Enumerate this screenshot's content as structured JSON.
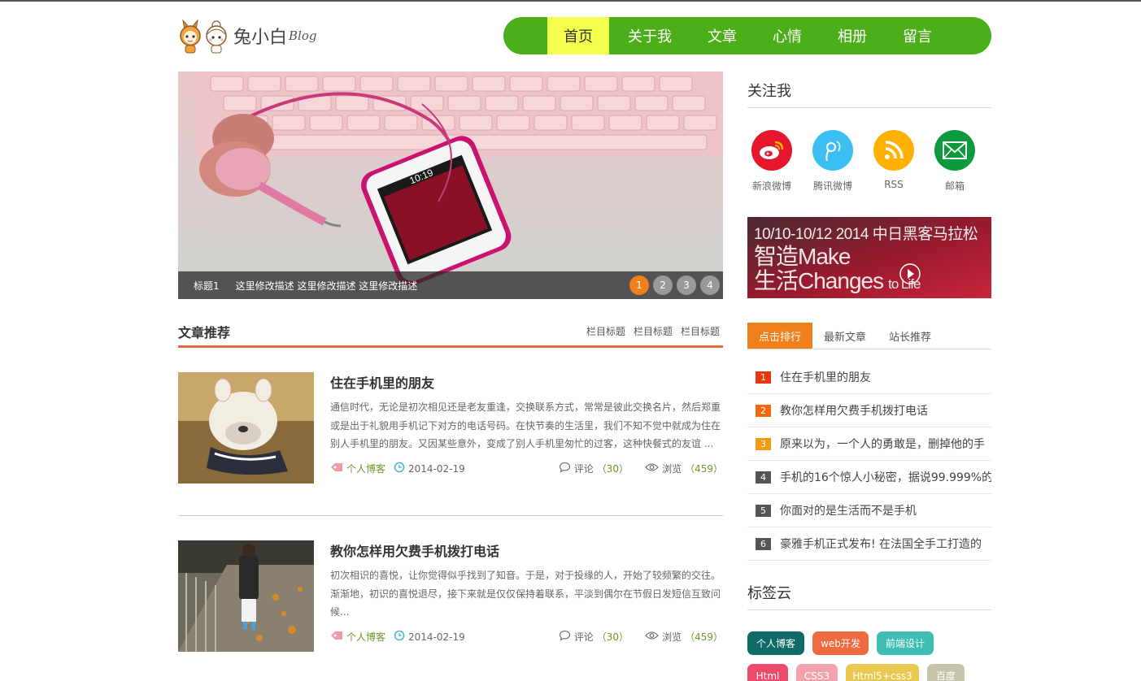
{
  "logo": {
    "text": "兔小白",
    "suffix": "Blog"
  },
  "nav": {
    "items": [
      "首页",
      "关于我",
      "文章",
      "心情",
      "相册",
      "留言"
    ],
    "active": "首页",
    "bg": "#4caf1a",
    "active_bg": "#f4ff4d"
  },
  "slider": {
    "title": "标题1",
    "desc": "这里修改描述 这里修改描述 这里修改描述",
    "pages": [
      "1",
      "2",
      "3",
      "4"
    ],
    "current": "1"
  },
  "section": {
    "title": "文章推荐",
    "links": [
      "栏目标题",
      "栏目标题",
      "栏目标题"
    ],
    "accent": "#e3663c"
  },
  "articles": [
    {
      "title": "住在手机里的朋友",
      "excerpt": "通信时代，无论是初次相见还是老友重逢，交换联系方式，常常是彼此交换名片，然后郑重或是出于礼貌用手机记下对方的电话号码。在快节奏的生活里，我们不知不觉中就成为住在别人手机里的朋友。又因某些意外，变成了别人手机里匆忙的过客，这种快餐式的友谊 ...",
      "category": "个人博客",
      "date": "2014-02-19",
      "comment_label": "评论",
      "comments": "（30）",
      "view_label": "浏览",
      "views": "（459）"
    },
    {
      "title": "教你怎样用欠费手机拨打电话",
      "excerpt": "初次相识的喜悦，让你觉得似乎找到了知音。于是，对于投缘的人，开始了较频繁的交往。渐渐地，初识的喜悦退尽，接下来就是仅仅保持着联系，平淡到偶尔在节假日发短信互致问候...",
      "category": "个人博客",
      "date": "2014-02-19",
      "comment_label": "评论",
      "comments": "（30）",
      "view_label": "浏览",
      "views": "（459）"
    }
  ],
  "follow": {
    "title": "关注我",
    "items": [
      {
        "label": "新浪微博",
        "icon": "weibo-icon",
        "color": "#e6162d"
      },
      {
        "label": "腾讯微博",
        "icon": "tencent-weibo-icon",
        "color": "#3bbef2"
      },
      {
        "label": "RSS",
        "icon": "rss-icon",
        "color": "#ffb000"
      },
      {
        "label": "邮箱",
        "icon": "mail-icon",
        "color": "#0c9a3c"
      }
    ]
  },
  "ad": {
    "line1": "10/10-10/12  2014 中日黑客马拉松",
    "line2a": "智造Make",
    "line2b": "生活Changes",
    "line2c": "to Life"
  },
  "tabs": {
    "items": [
      "点击排行",
      "最新文章",
      "站长推荐"
    ],
    "active": "点击排行",
    "accent": "#f0801c"
  },
  "ranking": [
    {
      "num": "1",
      "text": "住在手机里的朋友",
      "color": "#e8360e"
    },
    {
      "num": "2",
      "text": "教你怎样用欠费手机拨打电话",
      "color": "#f06a0c"
    },
    {
      "num": "3",
      "text": "原来以为，一个人的勇敢是，删掉他的手",
      "color": "#f39a12"
    },
    {
      "num": "4",
      "text": "手机的16个惊人小秘密，据说99.999%的",
      "color": "#555555"
    },
    {
      "num": "5",
      "text": "你面对的是生活而不是手机",
      "color": "#555555"
    },
    {
      "num": "6",
      "text": "豪雅手机正式发布! 在法国全手工打造的",
      "color": "#555555"
    }
  ],
  "tagcloud": {
    "title": "标签云",
    "tags": [
      {
        "text": "个人博客",
        "color": "#0e6b67"
      },
      {
        "text": "web开发",
        "color": "#ee6a3f"
      },
      {
        "text": "前端设计",
        "color": "#3fbcb3"
      },
      {
        "text": "Html",
        "color": "#ee4a6a"
      },
      {
        "text": "CSS3",
        "color": "#f3a3ad"
      },
      {
        "text": "Html5+css3",
        "color": "#e8c84f"
      },
      {
        "text": "百度",
        "color": "#c6c3a8"
      }
    ]
  }
}
